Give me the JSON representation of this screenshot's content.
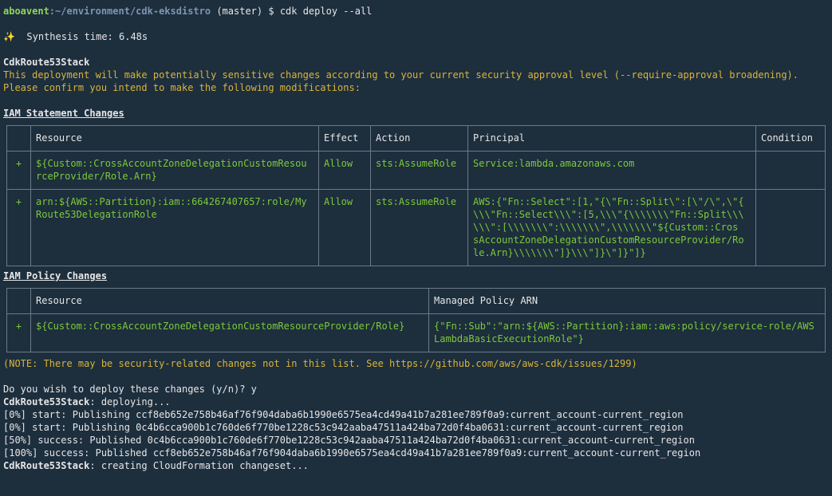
{
  "prompt": {
    "user": "aboavent",
    "path": "~/environment/cdk-eksdistro",
    "branch": " (master) $ ",
    "command": "cdk deploy --all"
  },
  "synth": {
    "icon": "✨",
    "text": "  Synthesis time: 6.48s"
  },
  "stack_name": "CdkRoute53Stack",
  "warning": [
    "This deployment will make potentially sensitive changes according to your current security approval level (--require-approval broadening).",
    "Please confirm you intend to make the following modifications:"
  ],
  "iam_statement": {
    "heading": "IAM Statement Changes",
    "headers": [
      "",
      "Resource",
      "Effect",
      "Action",
      "Principal",
      "Condition"
    ],
    "rows": [
      {
        "sign": "+",
        "resource": "${Custom::CrossAccountZoneDelegationCustomResou\nrceProvider/Role.Arn}",
        "effect": "Allow",
        "action": "sts:AssumeRole",
        "principal": "Service:lambda.amazonaws.com",
        "condition": ""
      },
      {
        "sign": "+",
        "resource": "arn:${AWS::Partition}:iam::664267407657:role/My\nRoute53DelegationRole",
        "effect": "Allow",
        "action": "sts:AssumeRole",
        "principal": "AWS:{\"Fn::Select\":[1,\"{\\\"Fn::Split\\\":[\\\"/\\\",\\\"{\n\\\\\\\"Fn::Select\\\\\\\":[5,\\\\\\\"{\\\\\\\\\\\\\\\"Fn::Split\\\\\\\n\\\\\\\":[\\\\\\\\\\\\\\\":\\\\\\\\\\\\\\\",\\\\\\\\\\\\\\\"${Custom::Cros\nsAccountZoneDelegationCustomResourceProvider/Ro\nle.Arn}\\\\\\\\\\\\\\\"]}\\\\\\\"]}\\\"]}\"]}",
        "condition": ""
      }
    ]
  },
  "iam_policy": {
    "heading": "IAM Policy Changes",
    "headers": [
      "",
      "Resource",
      "Managed Policy ARN"
    ],
    "rows": [
      {
        "sign": "+",
        "resource": "${Custom::CrossAccountZoneDelegationCustomResourceProvider/Role}",
        "arn": "{\"Fn::Sub\":\"arn:${AWS::Partition}:iam::aws:policy/service-role/AWS\nLambdaBasicExecutionRole\"}"
      }
    ]
  },
  "note": "(NOTE: There may be security-related changes not in this list. See https://github.com/aws/aws-cdk/issues/1299)",
  "confirm": "Do you wish to deploy these changes (y/n)? y",
  "deploying": {
    "stack": "CdkRoute53Stack",
    "text": ": deploying..."
  },
  "log": [
    "[0%] start: Publishing ccf8eb652e758b46af76f904daba6b1990e6575ea4cd49a41b7a281ee789f0a9:current_account-current_region",
    "[0%] start: Publishing 0c4b6cca900b1c760de6f770be1228c53c942aaba47511a424ba72d0f4ba0631:current_account-current_region",
    "[50%] success: Published 0c4b6cca900b1c760de6f770be1228c53c942aaba47511a424ba72d0f4ba0631:current_account-current_region",
    "[100%] success: Published ccf8eb652e758b46af76f904daba6b1990e6575ea4cd49a41b7a281ee789f0a9:current_account-current_region"
  ],
  "final": {
    "stack": "CdkRoute53Stack",
    "text": ": creating CloudFormation changeset..."
  }
}
